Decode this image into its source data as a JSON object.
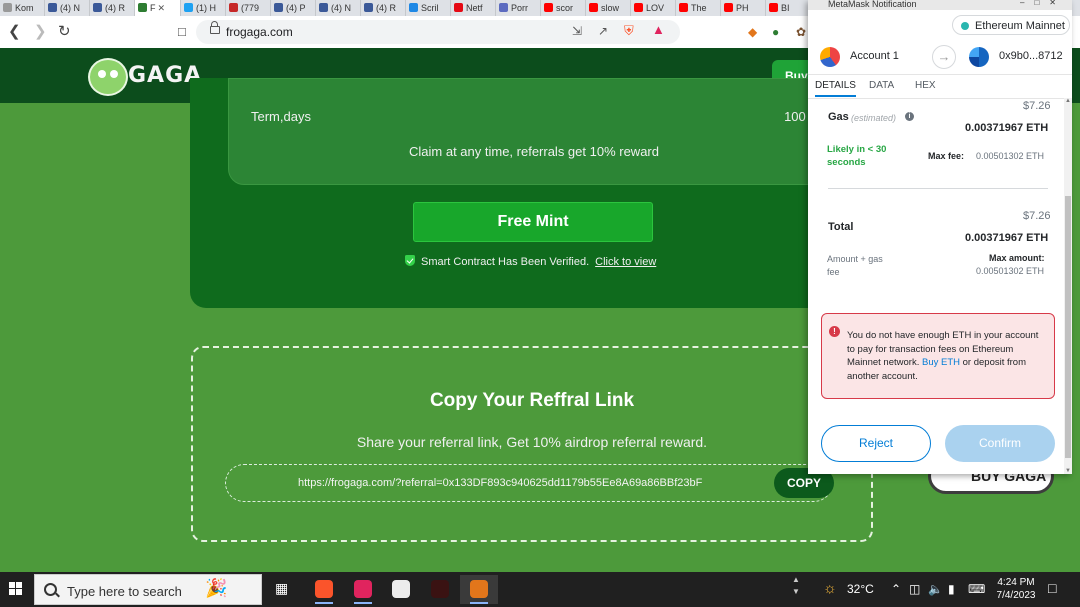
{
  "browser": {
    "tabs": [
      {
        "label": "Kom",
        "color": "#999999"
      },
      {
        "label": "(4) N",
        "color": "#3b5998"
      },
      {
        "label": "(4) R",
        "color": "#3b5998"
      },
      {
        "label": "F",
        "color": "#2e7d32",
        "active": true
      },
      {
        "label": "(1) H",
        "color": "#1da1f2"
      },
      {
        "label": "(779",
        "color": "#c62828"
      },
      {
        "label": "(4) P",
        "color": "#3b5998"
      },
      {
        "label": "(4) N",
        "color": "#3b5998"
      },
      {
        "label": "(4) R",
        "color": "#3b5998"
      },
      {
        "label": "Scril",
        "color": "#1e88e5"
      },
      {
        "label": "Netf",
        "color": "#e50914"
      },
      {
        "label": "Porr",
        "color": "#5c6bc0"
      },
      {
        "label": "scor",
        "color": "#ff0000"
      },
      {
        "label": "slow",
        "color": "#ff0000"
      },
      {
        "label": "LOV",
        "color": "#ff0000"
      },
      {
        "label": "The",
        "color": "#ff0000"
      },
      {
        "label": "PH",
        "color": "#ff0000"
      },
      {
        "label": "BI",
        "color": "#ff0000"
      }
    ],
    "url": "frogaga.com"
  },
  "site": {
    "logo_text": "GAGA",
    "buy_label": "Buy",
    "term_label": "Term,days",
    "term_value": "100 Days",
    "claim_text": "Claim at any time, referrals get 10% reward",
    "mint_label": "Free Mint",
    "verified_text": "Smart Contract Has Been Verified.",
    "verified_link": "Click to view",
    "ref_title": "Copy Your Reffral Link",
    "ref_subtitle": "Share your referral link, Get 10% airdrop referral reward.",
    "ref_link": "https://frogaga.com/?referral=0x133DF893c940625dd1179b55Ee8A69a86BBf23bF",
    "copy_label": "COPY",
    "buy_gaga_label": "BUY GAGA"
  },
  "metamask": {
    "window_title": "MetaMask Notification",
    "network": "Ethereum Mainnet",
    "from_account": "Account 1",
    "to_address": "0x9b0...8712",
    "tabs": [
      "DETAILS",
      "DATA",
      "HEX"
    ],
    "gas": {
      "label": "Gas",
      "estimated": "(estimated)",
      "fiat": "$7.26",
      "eth": "0.00371967 ETH",
      "likely": "Likely in < 30 seconds",
      "max_fee_label": "Max fee:",
      "max_fee_value": "0.00501302 ETH"
    },
    "total": {
      "label": "Total",
      "fiat": "$7.26",
      "eth": "0.00371967 ETH",
      "sub_label": "Amount + gas fee",
      "max_amount_label": "Max amount:",
      "max_amount_value": "0.00501302 ETH"
    },
    "error_text": "You do not have enough ETH in your account to pay for transaction fees on Ethereum Mainnet network.",
    "error_link": "Buy ETH",
    "error_tail": "or deposit from another account.",
    "reject_label": "Reject",
    "confirm_label": "Confirm"
  },
  "taskbar": {
    "search_placeholder": "Type here to search",
    "temperature": "32°C",
    "time": "4:24 PM",
    "date": "7/4/2023"
  }
}
